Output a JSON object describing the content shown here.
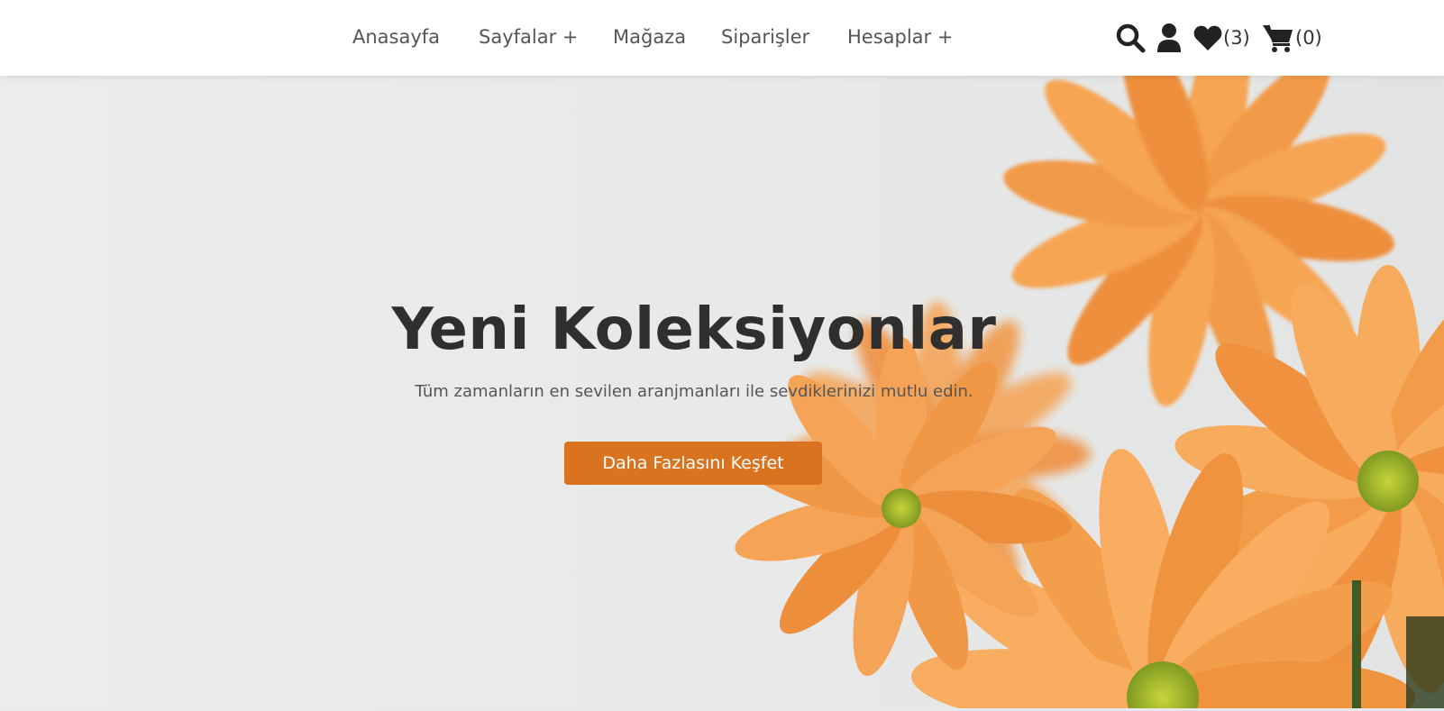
{
  "nav": {
    "items": [
      {
        "label": "Anasayfa"
      },
      {
        "label": "Sayfalar +"
      },
      {
        "label": "Mağaza"
      },
      {
        "label": "Siparişler"
      },
      {
        "label": "Hesaplar +"
      }
    ]
  },
  "header_icons": {
    "search": {
      "icon": "search-icon"
    },
    "account": {
      "icon": "user-icon"
    },
    "wishlist": {
      "icon": "heart-icon",
      "count": "(3)"
    },
    "cart": {
      "icon": "cart-icon",
      "count": "(0)"
    }
  },
  "hero": {
    "title": "Yeni Koleksiyonlar",
    "subtitle": "Tüm zamanların en sevilen aranjmanları ile sevdiklerinizi mutlu edin.",
    "cta_label": "Daha Fazlasını Keşfet"
  },
  "colors": {
    "accent": "#d97320",
    "flower": "#f19a4a",
    "background": "#e8eaea"
  }
}
